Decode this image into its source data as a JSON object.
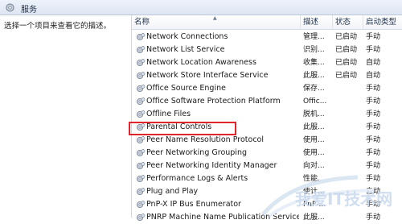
{
  "window": {
    "title": "服务"
  },
  "left_pane": {
    "description_prompt": "选择一个项目来查看它的描述。"
  },
  "columns": {
    "name": "名称",
    "description": "描述",
    "status": "状态",
    "startup": "启动类型"
  },
  "services": [
    {
      "name": "Network Connections",
      "description": "管理...",
      "status": "已启动",
      "startup": "手动"
    },
    {
      "name": "Network List Service",
      "description": "识别...",
      "status": "已启动",
      "startup": "手动"
    },
    {
      "name": "Network Location Awareness",
      "description": "收集...",
      "status": "已启动",
      "startup": "自动"
    },
    {
      "name": "Network Store Interface Service",
      "description": "此服...",
      "status": "已启动",
      "startup": "自动"
    },
    {
      "name": "Office  Source Engine",
      "description": "保存...",
      "status": "",
      "startup": "手动"
    },
    {
      "name": "Office Software Protection Platform",
      "description": "Offic...",
      "status": "",
      "startup": "手动"
    },
    {
      "name": "Offline Files",
      "description": "脱机...",
      "status": "",
      "startup": "手动"
    },
    {
      "name": "Parental Controls",
      "description": "此服...",
      "status": "",
      "startup": "手动"
    },
    {
      "name": "Peer Name Resolution Protocol",
      "description": "使用...",
      "status": "",
      "startup": "手动"
    },
    {
      "name": "Peer Networking Grouping",
      "description": "使用...",
      "status": "",
      "startup": "手动"
    },
    {
      "name": "Peer Networking Identity Manager",
      "description": "向对...",
      "status": "",
      "startup": "手动"
    },
    {
      "name": "Performance Logs & Alerts",
      "description": "性能...",
      "status": "",
      "startup": "手动"
    },
    {
      "name": "Plug and Play",
      "description": "使计...",
      "status": "",
      "startup": "自动"
    },
    {
      "name": "PnP-X IP Bus Enumerator",
      "description": "PnP-...",
      "status": "",
      "startup": "手动"
    },
    {
      "name": "PNRP Machine Name Publication Service",
      "description": "此服...",
      "status": "",
      "startup": "手动"
    }
  ],
  "highlighted_service": "Parental Controls",
  "watermark": {
    "text": "我爱IT技术网"
  },
  "colors": {
    "highlight_border": "#e0252b",
    "header_text": "#1e2f4a"
  }
}
